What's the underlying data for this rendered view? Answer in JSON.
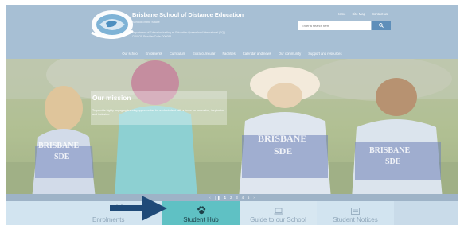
{
  "header": {
    "school_name": "Brisbane School of Distance Education",
    "tagline": "School of the future",
    "dept_line1": "Department of Education trading as Education Queensland International (EQI)",
    "dept_line2": "CRICOS Provider Code: 00608A",
    "top_links": [
      "Home",
      "Site Map",
      "Contact us"
    ],
    "search_placeholder": "Enter a search term"
  },
  "nav": {
    "items": [
      "Our school",
      "Enrolments",
      "Curriculum",
      "Extra-curricular",
      "Facilities",
      "Calendar and news",
      "Our community",
      "Support and resources"
    ]
  },
  "hero": {
    "mission_title": "Our mission",
    "mission_text": "To provide highly engaging learning opportunities for each student with a focus on innovation, inspiration and inclusion.",
    "shirt_text": [
      "BRISBANE",
      "SDE"
    ]
  },
  "pager": {
    "prev": "‹",
    "pause": "❚❚",
    "pages": [
      "1",
      "2",
      "3",
      "4",
      "5"
    ],
    "active_index": 0,
    "next": "›"
  },
  "tabs": {
    "enrolments": "Enrolments",
    "student_hub": "Student Hub",
    "guide": "Guide to our School",
    "notices": "Student Notices"
  },
  "icons": {
    "enrolments": "document-icon",
    "student_hub": "paw-icon",
    "guide": "laptop-icon",
    "notices": "noticeboard-icon",
    "pointer": "arrow-right-icon"
  },
  "colors": {
    "accent_tab": "#5fc1c4",
    "arrow": "#1f4a78",
    "header": "#a7bfd4",
    "search_button": "#5f8fba"
  }
}
